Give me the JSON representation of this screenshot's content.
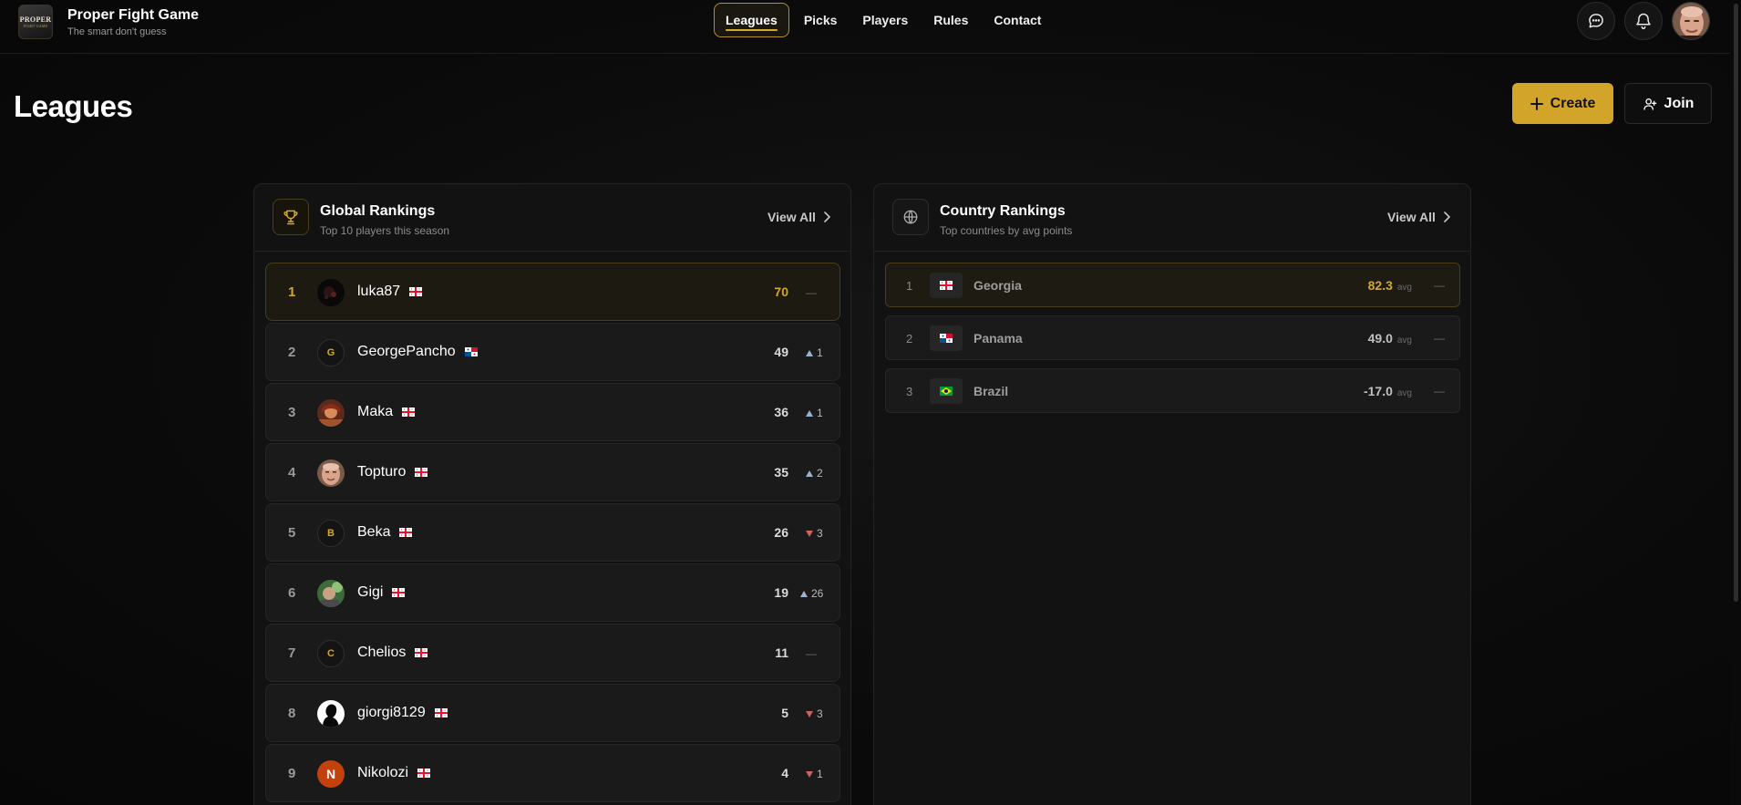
{
  "brand": {
    "logo_text": "PROPER",
    "logo_sub": "FIGHT GAME",
    "title": "Proper Fight Game",
    "subtitle": "The smart don't guess"
  },
  "nav": {
    "items": [
      {
        "label": "Leagues",
        "active": true
      },
      {
        "label": "Picks",
        "active": false
      },
      {
        "label": "Players",
        "active": false
      },
      {
        "label": "Rules",
        "active": false
      },
      {
        "label": "Contact",
        "active": false
      }
    ]
  },
  "header_icons": [
    "chat-icon",
    "bell-icon",
    "user-avatar"
  ],
  "page": {
    "title": "Leagues",
    "create_label": "Create",
    "join_label": "Join"
  },
  "global": {
    "title": "Global Rankings",
    "subtitle": "Top 10 players this season",
    "view_all": "View All",
    "rows": [
      {
        "rank": "1",
        "name": "luka87",
        "avatar": "photo-dark",
        "flag": "georgia",
        "points": "70",
        "change": "—",
        "dir": "flat"
      },
      {
        "rank": "2",
        "name": "GeorgePancho",
        "avatar": "G",
        "flag": "panama",
        "points": "49",
        "change": "1",
        "dir": "up"
      },
      {
        "rank": "3",
        "name": "Maka",
        "avatar": "photo-warm",
        "flag": "georgia",
        "points": "36",
        "change": "1",
        "dir": "up"
      },
      {
        "rank": "4",
        "name": "Topturo",
        "avatar": "photo-face",
        "flag": "georgia",
        "points": "35",
        "change": "2",
        "dir": "up"
      },
      {
        "rank": "5",
        "name": "Beka",
        "avatar": "B",
        "flag": "georgia",
        "points": "26",
        "change": "3",
        "dir": "down"
      },
      {
        "rank": "6",
        "name": "Gigi",
        "avatar": "photo-green",
        "flag": "georgia",
        "points": "19",
        "change": "26",
        "dir": "up"
      },
      {
        "rank": "7",
        "name": "Chelios",
        "avatar": "C",
        "flag": "georgia",
        "points": "11",
        "change": "—",
        "dir": "flat"
      },
      {
        "rank": "8",
        "name": "giorgi8129",
        "avatar": "photo-silhouette",
        "flag": "georgia",
        "points": "5",
        "change": "3",
        "dir": "down"
      },
      {
        "rank": "9",
        "name": "Nikolozi",
        "avatar": "N",
        "flag": "georgia",
        "points": "4",
        "change": "1",
        "dir": "down"
      }
    ]
  },
  "country": {
    "title": "Country Rankings",
    "subtitle": "Top countries by avg points",
    "view_all": "View All",
    "avg_label": "avg",
    "rows": [
      {
        "rank": "1",
        "name": "Georgia",
        "flag": "georgia",
        "score": "82.3",
        "change": "—"
      },
      {
        "rank": "2",
        "name": "Panama",
        "flag": "panama",
        "score": "49.0",
        "change": "—"
      },
      {
        "rank": "3",
        "name": "Brazil",
        "flag": "brazil",
        "score": "-17.0",
        "change": "—"
      }
    ]
  },
  "colors": {
    "accent": "#d4a82b",
    "button": "#d2a429",
    "background": "#0a0a0a",
    "panel": "#121212"
  }
}
